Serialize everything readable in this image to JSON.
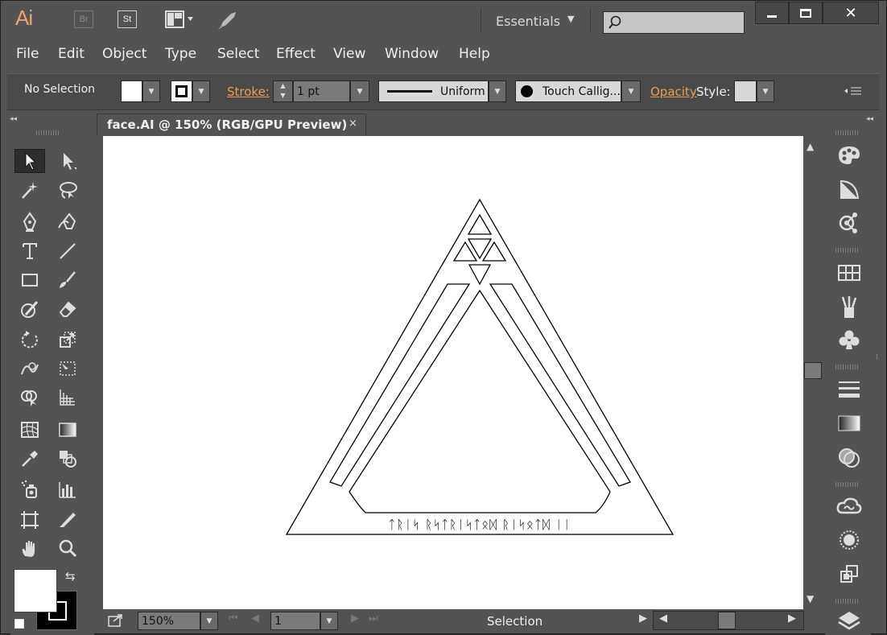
{
  "app": {
    "logo": "Ai",
    "bridge_badge": "Br",
    "stock_badge": "St",
    "workspace": "Essentials"
  },
  "window_controls": {
    "minimize": "▁",
    "maximize": "☐",
    "close": "✕"
  },
  "menu": [
    "File",
    "Edit",
    "Object",
    "Type",
    "Select",
    "Effect",
    "View",
    "Window",
    "Help"
  ],
  "control_bar": {
    "selection_status": "No Selection",
    "stroke_label": "Stroke:",
    "stroke_weight": "1 pt",
    "stroke_profile": "Uniform",
    "brush": "Touch Callig...",
    "opacity_label": "Opacity",
    "style_label": "Style:"
  },
  "document": {
    "tab_title": "face.AI @ 150% (RGB/GPU Preview)",
    "close": "×",
    "glyph_text": "ᛏᚱᛁᛋ ᚱᛋᛏᚱᛁᛋᛏᛟᛞ ᚱᛁᛋᛟᛏᛞ ᛁᛁ"
  },
  "status_bar": {
    "zoom": "150%",
    "artboard_number": "1",
    "current_tool": "Selection"
  },
  "colors": {
    "accent_orange": "#e89c4c",
    "ui_gray": "#535353",
    "logo_orange": "#e8a66e"
  },
  "icons": {
    "tools": [
      "selection-tool-icon",
      "direct-selection-tool-icon",
      "magic-wand-icon",
      "lasso-icon",
      "pen-tool-icon",
      "curvature-tool-icon",
      "type-tool-icon",
      "line-segment-icon",
      "rectangle-tool-icon",
      "paintbrush-icon",
      "shaper-tool-icon",
      "eraser-icon",
      "rotate-tool-icon",
      "scale-tool-icon",
      "warp-tool-icon",
      "free-transform-icon",
      "shape-builder-icon",
      "perspective-grid-icon",
      "mesh-tool-icon",
      "gradient-tool-icon",
      "eyedropper-icon",
      "blend-tool-icon",
      "symbol-sprayer-icon",
      "column-graph-icon",
      "artboard-tool-icon",
      "slice-tool-icon",
      "hand-tool-icon",
      "zoom-tool-icon"
    ],
    "panels": [
      "color-panel-icon",
      "color-guide-icon",
      "graphic-styles-icon",
      "swatches-icon",
      "brushes-icon",
      "symbols-icon",
      "stroke-panel-icon",
      "gradient-panel-icon",
      "transparency-icon",
      "cc-libraries-icon",
      "appearance-icon",
      "transform-icon",
      "layers-icon"
    ]
  }
}
